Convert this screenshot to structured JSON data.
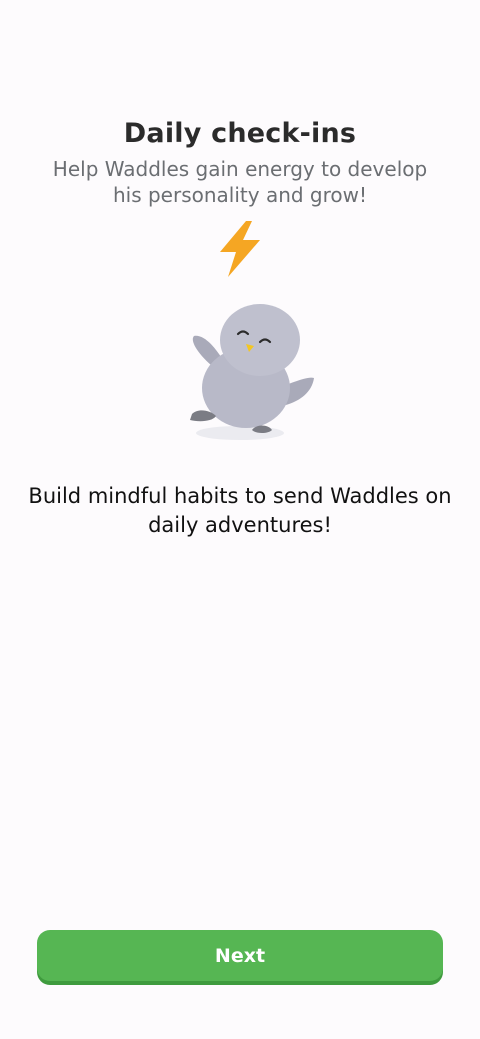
{
  "onboarding": {
    "title": "Daily check-ins",
    "subtitle": "Help Waddles gain energy to develop his personality and grow!",
    "description": "Build mindful habits to send Waddles on daily adventures!",
    "illustration": {
      "icon": "lightning-bolt-icon",
      "character": "penguin"
    }
  },
  "actions": {
    "next_label": "Next"
  },
  "colors": {
    "background": "#fdfbfd",
    "accent_green": "#56b653",
    "bolt_orange": "#f5a623",
    "penguin_gray": "#b8b9c8"
  }
}
